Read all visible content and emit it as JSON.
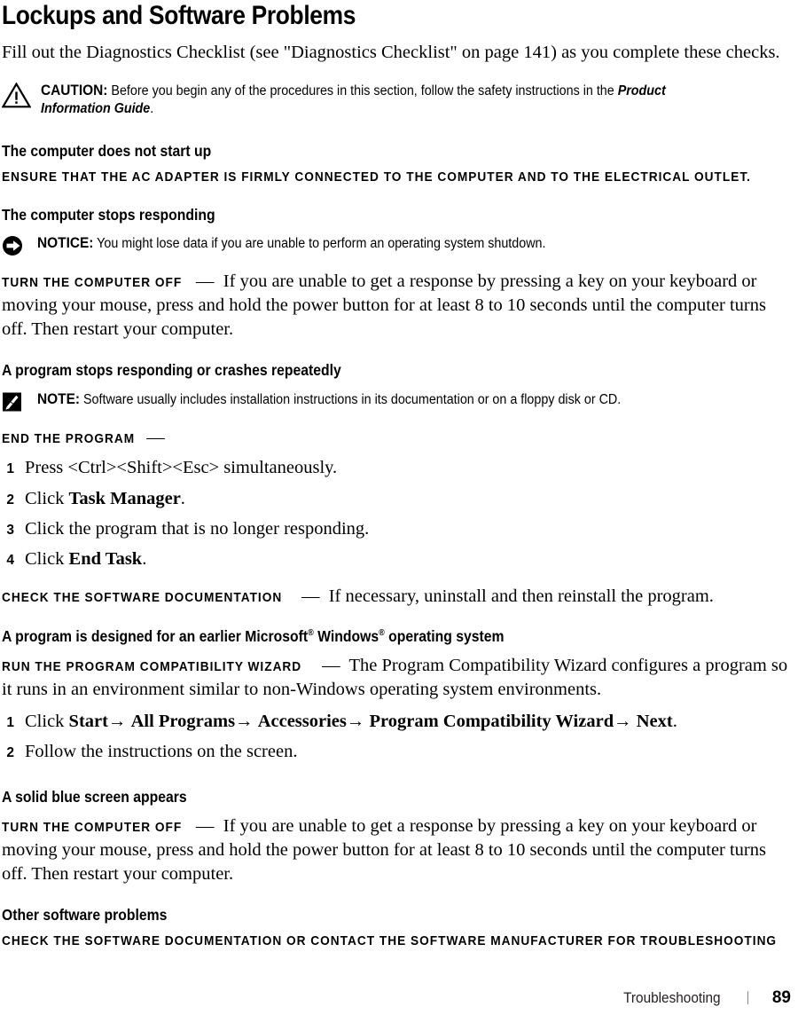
{
  "page": {
    "title": "Lockups and Software Problems",
    "intro": "Fill out the Diagnostics Checklist (see \"Diagnostics Checklist\" on page 141) as you complete these checks."
  },
  "callouts": {
    "caution": {
      "icon": "warning-triangle-icon",
      "lead": "CAUTION:",
      "text_before_italic": "Before you begin any of the procedures in this section, follow the safety instructions in the ",
      "italic": "Product Information Guide",
      "text_after_italic": "."
    },
    "notice": {
      "icon": "notice-arrow-circle-icon",
      "lead": "NOTICE:",
      "text": "You might lose data if you are unable to perform an operating system shutdown."
    },
    "note": {
      "icon": "note-pen-icon",
      "lead": "NOTE:",
      "text": "Software usually includes installation instructions in its documentation or on a floppy disk or CD."
    }
  },
  "sections": {
    "not_start": {
      "heading": "The computer does not start up",
      "runin": "Ensure that the AC adapter is firmly connected to the computer and to the electrical outlet."
    },
    "stops_responding": {
      "heading": "The computer stops responding",
      "runin": "Turn the computer off",
      "dash": "—",
      "body": "If you are unable to get a response by pressing a key on your keyboard or moving your mouse, press and hold the power button for at least 8 to 10 seconds until the computer turns off. Then restart your computer."
    },
    "program_crashes": {
      "heading": "A program stops responding or crashes repeatedly",
      "runin_end": "End the program",
      "dash": "—",
      "steps": [
        {
          "num": "1",
          "text": "Press <Ctrl><Shift><Esc> simultaneously."
        },
        {
          "num": "2",
          "text_pre": "Click ",
          "bold": "Task Manager",
          "text_post": "."
        },
        {
          "num": "3",
          "text": "Click the program that is no longer responding."
        },
        {
          "num": "4",
          "text_pre": "Click ",
          "bold": "End Task",
          "text_post": "."
        }
      ],
      "runin_check": "Check the software documentation",
      "check_body": "If necessary, uninstall and then reinstall the program."
    },
    "earlier_windows": {
      "heading_pre": "A program is designed for an earlier Microsoft",
      "sup1": "®",
      "heading_mid": " Windows",
      "sup2": "®",
      "heading_post": " operating system",
      "runin": "Run the Program Compatibility Wizard",
      "dash": "—",
      "body": "The Program Compatibility Wizard configures a program so it runs in an environment similar to non-Windows operating system environments.",
      "steps": [
        {
          "num": "1",
          "text_pre": "Click ",
          "path": [
            {
              "label": "Start",
              "arrow": "→"
            },
            {
              "label": "All Programs",
              "arrow": "→"
            },
            {
              "label": "Accessories",
              "arrow": "→"
            },
            {
              "label": "Program Compatibility Wizard",
              "arrow": "→"
            },
            {
              "label": "Next",
              "arrow": ""
            }
          ],
          "text_post": "."
        },
        {
          "num": "2",
          "text": "Follow the instructions on the screen."
        }
      ]
    },
    "blue_screen": {
      "heading": "A solid blue screen appears",
      "runin": "Turn the computer off",
      "dash": "—",
      "body": "If you are unable to get a response by pressing a key on your keyboard or moving your mouse, press and hold the power button for at least 8 to 10 seconds until the computer turns off. Then restart your computer."
    },
    "other_software": {
      "heading": "Other software problems",
      "runin": "Check the software documentation or contact the software manufacturer for troubleshooting"
    }
  },
  "footer": {
    "label": "Troubleshooting",
    "separator": "|",
    "page_number": "89"
  },
  "colors": {
    "text": "#000000",
    "footer_rule": "#8a8a8a"
  }
}
